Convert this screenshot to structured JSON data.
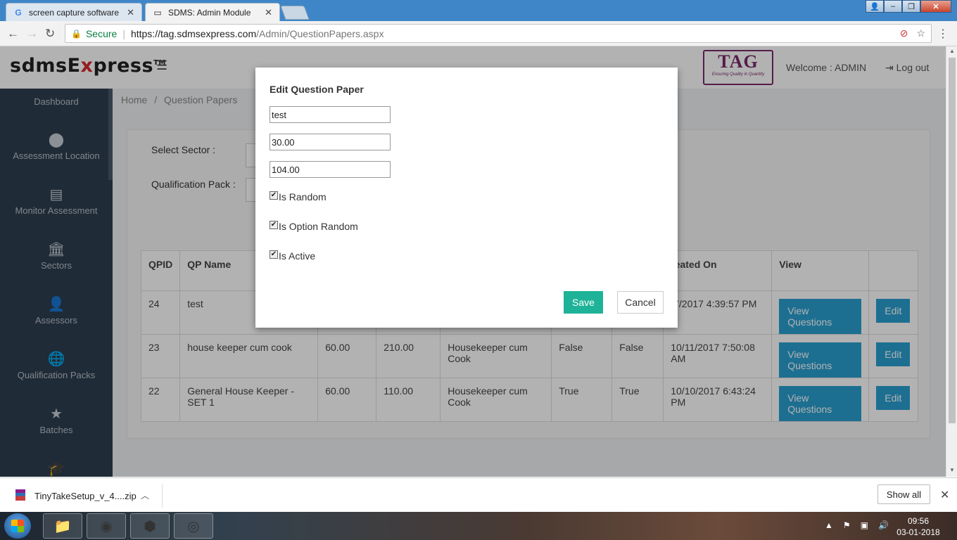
{
  "browser": {
    "tabs": [
      {
        "title": "screen capture software"
      },
      {
        "title": "SDMS: Admin Module"
      }
    ],
    "secure_label": "Secure",
    "url_host": "https://tag.sdmsexpress.com",
    "url_path": "/Admin/QuestionPapers.aspx"
  },
  "header": {
    "logo_pre": "sdmsE",
    "logo_x": "x",
    "logo_post": "press",
    "logo_tm": "TM",
    "partner_logo": "TAG",
    "partner_tagline": "Ensuring Quality in Quantity",
    "welcome": "Welcome : ADMIN",
    "logout": "Log out"
  },
  "sidebar": {
    "items": [
      {
        "label": "Dashboard",
        "icon": "dashboard-icon"
      },
      {
        "label": "Assessment Location",
        "icon": "map-marker-icon"
      },
      {
        "label": "Monitor Assessment",
        "icon": "list-icon"
      },
      {
        "label": "Sectors",
        "icon": "bank-icon"
      },
      {
        "label": "Assessors",
        "icon": "user-icon"
      },
      {
        "label": "Qualification Packs",
        "icon": "globe-icon"
      },
      {
        "label": "Batches",
        "icon": "star-icon"
      },
      {
        "label": "",
        "icon": "graduation-cap-icon"
      }
    ]
  },
  "breadcrumb": {
    "home": "Home",
    "sep": "/",
    "current": "Question Papers"
  },
  "filters": {
    "sector_label": "Select Sector :",
    "qp_label": "Qualification Pack :"
  },
  "table": {
    "headers": [
      "QPID",
      "QP Name",
      "",
      "",
      "",
      "",
      "",
      "reated On",
      "View",
      ""
    ],
    "rows": [
      {
        "qpid": "24",
        "name": "test",
        "c3": "",
        "c4": "",
        "c5": "",
        "c6": "",
        "c7": "",
        "created": "/7/2017 4:39:57 PM",
        "view": "View Questions",
        "edit": "Edit"
      },
      {
        "qpid": "23",
        "name": "house keeper cum cook",
        "c3": "60.00",
        "c4": "210.00",
        "c5": "Housekeeper cum Cook",
        "c6": "False",
        "c7": "False",
        "created": "10/11/2017 7:50:08 AM",
        "view": "View Questions",
        "edit": "Edit"
      },
      {
        "qpid": "22",
        "name": "General House Keeper - SET 1",
        "c3": "60.00",
        "c4": "110.00",
        "c5": "Housekeeper cum Cook",
        "c6": "True",
        "c7": "True",
        "created": "10/10/2017 6:43:24 PM",
        "view": "View Questions",
        "edit": "Edit"
      }
    ]
  },
  "modal": {
    "title": "Edit Question Paper",
    "name_value": "test",
    "field2_value": "30.00",
    "field3_value": "104.00",
    "checks": [
      {
        "label": "Is Random",
        "checked": true
      },
      {
        "label": "Is Option Random",
        "checked": true
      },
      {
        "label": "Is Active",
        "checked": true
      }
    ],
    "save": "Save",
    "cancel": "Cancel"
  },
  "downloads": {
    "file": "TinyTakeSetup_v_4....zip",
    "show_all": "Show all"
  },
  "taskbar": {
    "time": "09:56",
    "date": "03-01-2018"
  },
  "colors": {
    "sidebar": "#2d3e50",
    "save": "#1eb398",
    "action": "#2a9fd0"
  }
}
